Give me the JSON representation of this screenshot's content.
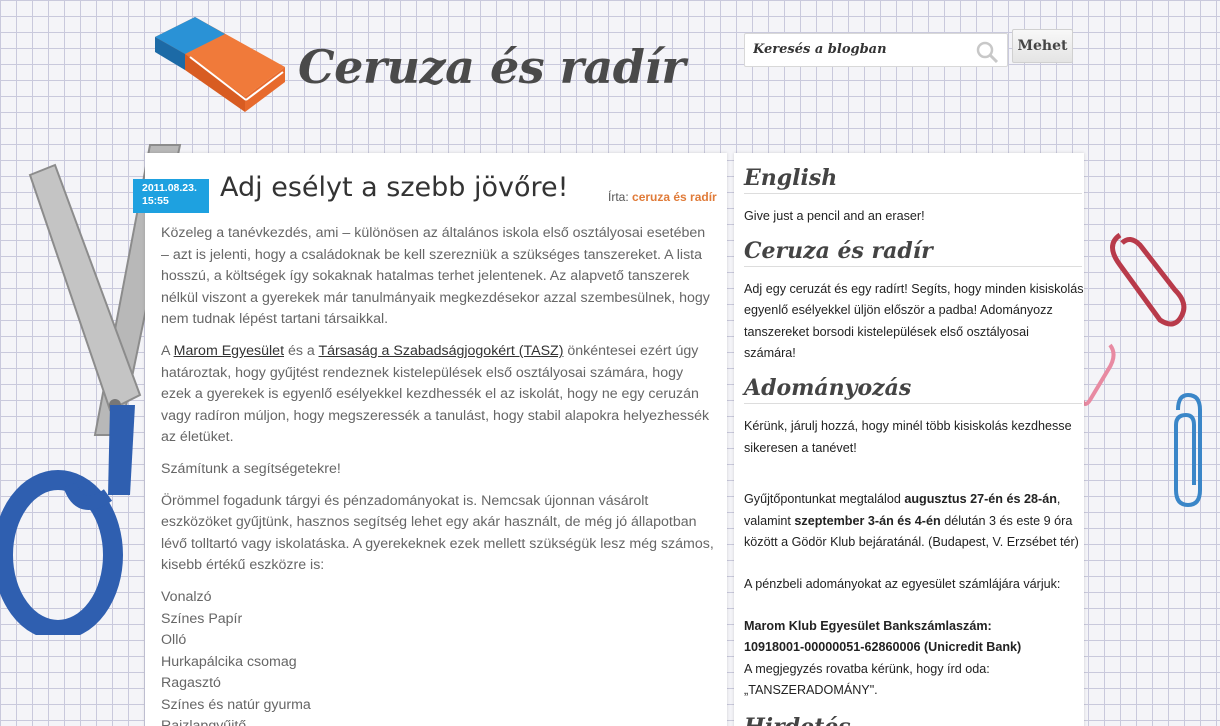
{
  "header": {
    "site_title": "Ceruza és radír",
    "search_placeholder": "Keresés a blogban",
    "search_button_label": "Mehet"
  },
  "post": {
    "date_line1": "2011.08.23.",
    "date_line2": "15:55",
    "title": "Adj esélyt a szebb jövőre!",
    "author_prefix": "Írta:",
    "author_name": "ceruza és radír",
    "p1": "Közeleg a tanévkezdés, ami – különösen az általános iskola első osztályosai esetében – azt is jelenti, hogy a családoknak be kell szerezniük a szükséges tanszereket. A lista hosszú, a költségek így sokaknak hatalmas terhet jelentenek. Az alapvető tanszerek nélkül viszont a gyerekek már tanulmányaik megkezdésekor azzal szembesülnek, hogy nem tudnak lépést tartani társaikkal.",
    "p2_a": "A ",
    "p2_link1": "Marom Egyesület",
    "p2_b": " és a ",
    "p2_link2": "Társaság a Szabadságjogokért (TASZ)",
    "p2_c": " önkéntesei ezért úgy határoztak, hogy gyűjtést rendeznek kistelepülések első osztályosai számára, hogy ezek a gyerekek is egyenlő esélyekkel kezdhessék el az iskolát, hogy ne egy ceruzán vagy radíron múljon, hogy megszeressék a tanulást, hogy stabil alapokra helyezhessék az életüket.",
    "p3": "Számítunk a segítségetekre!",
    "p4": "Örömmel fogadunk tárgyi és pénzadományokat is. Nemcsak újonnan vásárolt eszközöket gyűjtünk, hasznos segítség lehet egy akár használt, de még jó állapotban lévő tolltartó vagy iskolatáska. A gyerekeknek ezek mellett szükségük lesz még számos, kisebb értékű eszközre is:",
    "list": [
      "Vonalzó",
      "Színes Papír",
      "Olló",
      "Hurkapálcika csomag",
      "Ragasztó",
      "Színes és natúr gyurma",
      "Rajzlapgyűjtő"
    ]
  },
  "sidebar": {
    "h_english": "English",
    "english_text": "Give just a pencil and an eraser!",
    "h_ceruza": "Ceruza és radír",
    "ceruza_text": "Adj egy ceruzát és egy radírt! Segíts, hogy minden kisiskolás egyenlő esélyekkel üljön először a padba! Adományozz tanszereket borsodi kistelepülések első osztályosai számára!",
    "h_adomany": "Adományozás",
    "adomany_p1": "Kérünk, járulj hozzá, hogy minél több kisiskolás kezdhesse sikeresen a tanévet!",
    "adomany_p2_a": "Gyűjtőpontunkat megtalálod ",
    "adomany_p2_b1": "augusztus 27-én és 28-án",
    "adomany_p2_c": ", valamint ",
    "adomany_p2_b2": "szeptember 3-án és 4-én",
    "adomany_p2_d": " délután 3 és este 9 óra között a Gödör Klub bejáratánál. (Budapest, V. Erzsébet tér)",
    "adomany_p3": "A pénzbeli adományokat az egyesület számlájára várjuk:",
    "bank_label": "Marom Klub Egyesület Bankszámlaszám:",
    "bank_number": "10918001-00000051-62860006 (Unicredit Bank)",
    "note_line": "A megjegyzés rovatba kérünk, hogy írd oda:",
    "note_value": "„TANSZERADOMÁNY\".",
    "h_next": "Hirdetés"
  }
}
